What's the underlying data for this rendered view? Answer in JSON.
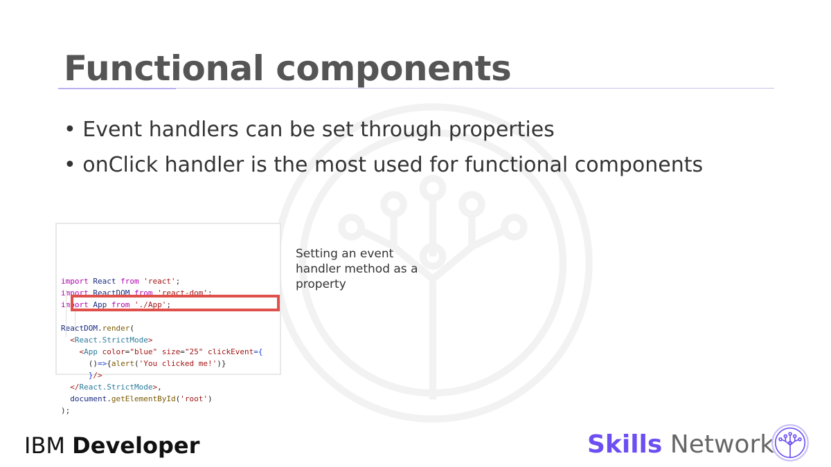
{
  "slide": {
    "title": "Functional components",
    "bullets": [
      "Event handlers can be set through properties",
      "onClick handler is the most used for functional components"
    ],
    "note": "Setting an event handler method as a property"
  },
  "code": {
    "lines": [
      [
        [
          "import ",
          "k"
        ],
        [
          "React ",
          "i"
        ],
        [
          "from ",
          "k"
        ],
        [
          "'react'",
          "s"
        ],
        [
          ";",
          "p"
        ]
      ],
      [
        [
          "import ",
          "k"
        ],
        [
          "ReactDOM ",
          "i"
        ],
        [
          "from ",
          "k"
        ],
        [
          "'react-dom'",
          "s"
        ],
        [
          ";",
          "p"
        ]
      ],
      [
        [
          "import ",
          "k"
        ],
        [
          "App ",
          "i"
        ],
        [
          "from ",
          "k"
        ],
        [
          "'./App'",
          "s"
        ],
        [
          ";",
          "p"
        ]
      ],
      [],
      [
        [
          "ReactDOM",
          "i"
        ],
        [
          ".",
          "p"
        ],
        [
          "render",
          "f"
        ],
        [
          "(",
          "p"
        ]
      ],
      [
        [
          "  <",
          "s"
        ],
        [
          "React.StrictMode",
          "t"
        ],
        [
          ">",
          "s"
        ]
      ],
      [
        [
          "    <",
          "s"
        ],
        [
          "App ",
          "t"
        ],
        [
          "color",
          "s"
        ],
        [
          "=",
          "p"
        ],
        [
          "\"blue\" ",
          "s"
        ],
        [
          "size",
          "s"
        ],
        [
          "=",
          "p"
        ],
        [
          "\"25\" ",
          "s"
        ],
        [
          "clickEvent",
          "s"
        ],
        [
          "={",
          "b"
        ]
      ],
      [
        [
          "      ()",
          "p"
        ],
        [
          "=>",
          "b"
        ],
        [
          "{",
          "p"
        ],
        [
          "alert",
          "f"
        ],
        [
          "(",
          "p"
        ],
        [
          "'You clicked me!'",
          "s"
        ],
        [
          ")}",
          "p"
        ]
      ],
      [
        [
          "      }",
          "b"
        ],
        [
          "/>",
          "s"
        ]
      ],
      [
        [
          "  </",
          "s"
        ],
        [
          "React.StrictMode",
          "t"
        ],
        [
          ">",
          "s"
        ],
        [
          ",",
          "p"
        ]
      ],
      [
        [
          "  document",
          "i"
        ],
        [
          ".",
          "p"
        ],
        [
          "getElementById",
          "f"
        ],
        [
          "(",
          "p"
        ],
        [
          "'root'",
          "s"
        ],
        [
          ")",
          "p"
        ]
      ],
      [
        [
          ");",
          "p"
        ]
      ]
    ]
  },
  "footer": {
    "ibm_prefix": "IBM",
    "ibm_name": "Developer",
    "skills": "Skills",
    "network": "Network"
  },
  "colors": {
    "accent": "#6c4ef2",
    "highlight": "#e0504a"
  }
}
